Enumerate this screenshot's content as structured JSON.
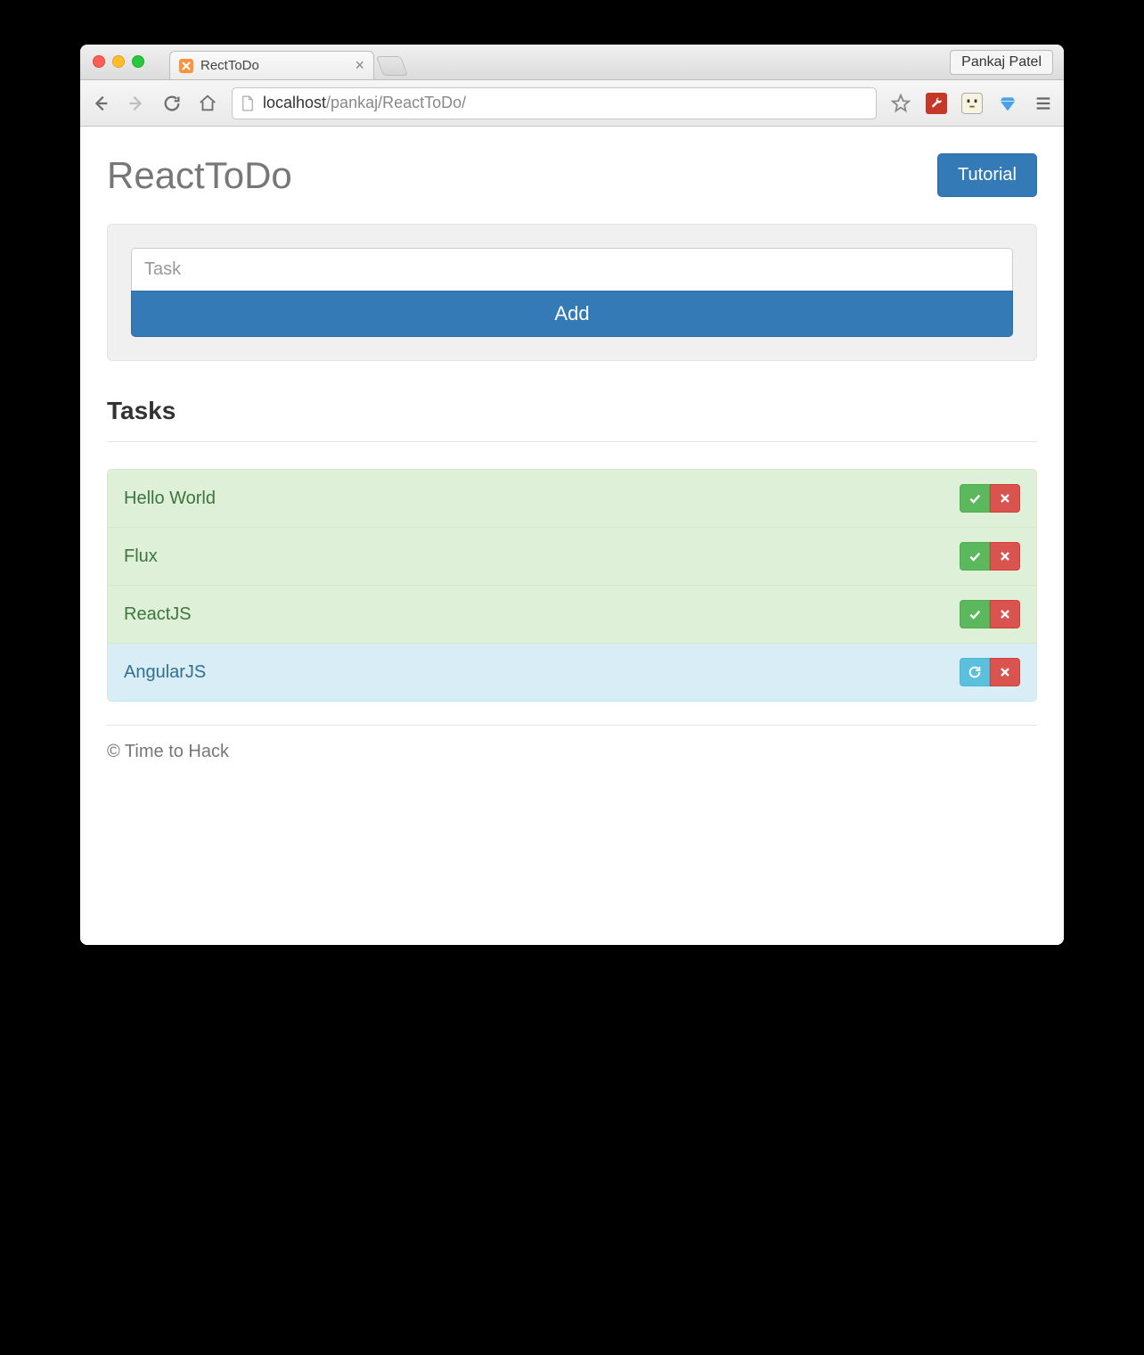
{
  "browser": {
    "tab_title": "RectToDo",
    "profile_name": "Pankaj Patel",
    "url_host": "localhost",
    "url_path": "/pankaj/ReactToDo/"
  },
  "header": {
    "title": "ReactToDo",
    "tutorial_label": "Tutorial"
  },
  "form": {
    "task_placeholder": "Task",
    "add_label": "Add"
  },
  "tasks": {
    "heading": "Tasks",
    "items": [
      {
        "label": "Hello World",
        "status": "success",
        "action_icon": "check"
      },
      {
        "label": "Flux",
        "status": "success",
        "action_icon": "check"
      },
      {
        "label": "ReactJS",
        "status": "success",
        "action_icon": "check"
      },
      {
        "label": "AngularJS",
        "status": "info",
        "action_icon": "refresh"
      }
    ]
  },
  "footer": {
    "text": "© Time to Hack"
  }
}
